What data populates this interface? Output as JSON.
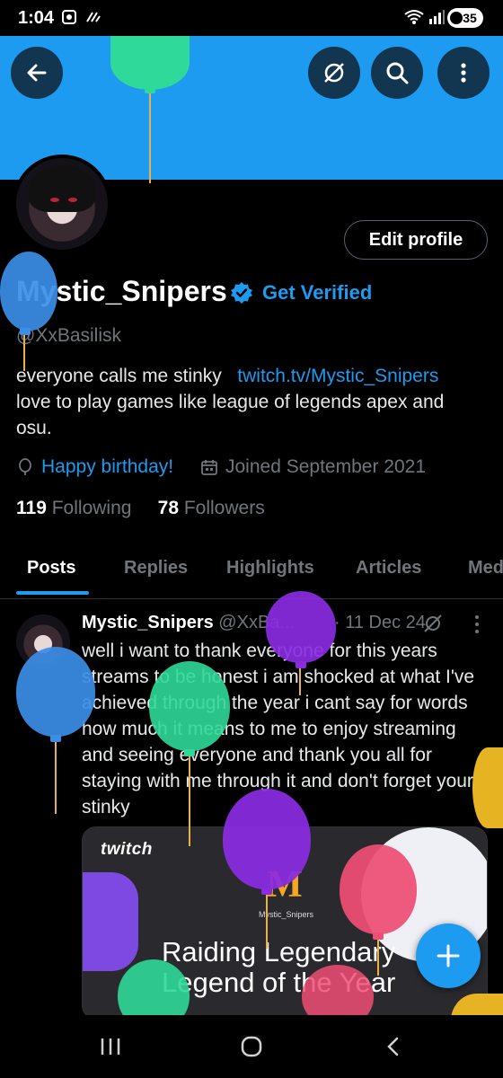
{
  "status_bar": {
    "time": "1:04",
    "battery": "35"
  },
  "header": {
    "back_icon": "arrow-left-icon",
    "grok_icon": "grok-icon",
    "search_icon": "search-icon",
    "more_icon": "more-vertical-icon"
  },
  "profile": {
    "edit_profile_label": "Edit profile",
    "display_name": "Mystic_Snipers",
    "get_verified_label": "Get Verified",
    "handle": "@XxBasilisk",
    "bio_line1": "everyone calls me stinky",
    "bio_link": "twitch.tv/Mystic_Snipers",
    "bio_line2": "love to play games like league of legends apex and osu.",
    "birthday_label": "Happy birthday!",
    "joined_label": "Joined September 2021",
    "following_count": "119",
    "following_label": "Following",
    "followers_count": "78",
    "followers_label": "Followers"
  },
  "tabs": [
    {
      "label": "Posts",
      "active": true
    },
    {
      "label": "Replies",
      "active": false
    },
    {
      "label": "Highlights",
      "active": false
    },
    {
      "label": "Articles",
      "active": false
    },
    {
      "label": "Med",
      "active": false
    }
  ],
  "post": {
    "name": "Mystic_Snipers",
    "handle": "@XxBa...",
    "date": "· 11 Dec 24",
    "text": "well i want to thank everyone for this years streams to be honest i am shocked at what I've achieved through the year i cant say for words how much it means to me to enjoy streaming and seeing everyone and thank you all for staying with me through it and don't forget your stinky",
    "card": {
      "brand": "twitch",
      "logo_letter": "M",
      "logo_caption": "Mystic_Snipers",
      "title": "Raiding Legendary Legend of the Year"
    }
  },
  "colors": {
    "accent": "#1d9bf0",
    "background": "#000000",
    "muted_text": "#71767b",
    "balloon_green": "#2fd99a",
    "balloon_blue": "#3b8de6",
    "balloon_purple": "#8a2be2",
    "balloon_pink": "#ee4d74",
    "balloon_yellow": "#e6b422"
  }
}
